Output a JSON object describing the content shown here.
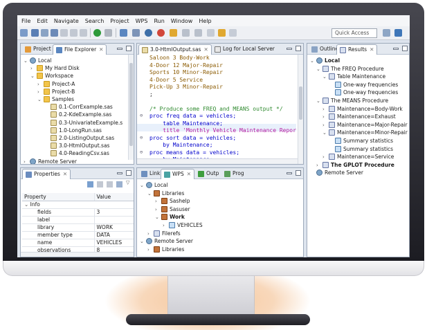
{
  "menu": [
    "File",
    "Edit",
    "Navigate",
    "Search",
    "Project",
    "WPS",
    "Run",
    "Window",
    "Help"
  ],
  "quick_access": "Quick Access",
  "left_panel": {
    "tabs": [
      "Project",
      "File Explorer"
    ],
    "tree": [
      {
        "label": "Local",
        "indent": 0,
        "arrow": "v",
        "icon": "computer"
      },
      {
        "label": "My Hard Disk",
        "indent": 1,
        "arrow": ">",
        "icon": "folder"
      },
      {
        "label": "Workspace",
        "indent": 1,
        "arrow": "v",
        "icon": "folder"
      },
      {
        "label": "Project-A",
        "indent": 2,
        "arrow": ">",
        "icon": "folder"
      },
      {
        "label": "Project-B",
        "indent": 2,
        "arrow": ">",
        "icon": "folder"
      },
      {
        "label": "Samples",
        "indent": 2,
        "arrow": "v",
        "icon": "folder"
      },
      {
        "label": "0.1-CorrExample.sas",
        "indent": 3,
        "arrow": "",
        "icon": "sas"
      },
      {
        "label": "0.2-KdeExample.sas",
        "indent": 3,
        "arrow": "",
        "icon": "sas"
      },
      {
        "label": "0.3-UnivariateExample.s",
        "indent": 3,
        "arrow": "",
        "icon": "sas"
      },
      {
        "label": "1.0-LongRun.sas",
        "indent": 3,
        "arrow": "",
        "icon": "sas"
      },
      {
        "label": "2.0-ListingOutput.sas",
        "indent": 3,
        "arrow": "",
        "icon": "sas"
      },
      {
        "label": "3.0-HtmlOutput.sas",
        "indent": 3,
        "arrow": "",
        "icon": "sas"
      },
      {
        "label": "4.0-ReadingCsv.sas",
        "indent": 3,
        "arrow": "",
        "icon": "sas"
      },
      {
        "label": "Remote Server",
        "indent": 0,
        "arrow": ">",
        "icon": "server"
      }
    ]
  },
  "properties": {
    "tab": "Properties",
    "col_property": "Property",
    "col_value": "Value",
    "group": "Info",
    "rows": [
      {
        "name": "fields",
        "value": "3"
      },
      {
        "name": "label",
        "value": ""
      },
      {
        "name": "library",
        "value": "WORK"
      },
      {
        "name": "member type",
        "value": "DATA"
      },
      {
        "name": "name",
        "value": "VEHICLES"
      },
      {
        "name": "observations",
        "value": "8"
      }
    ]
  },
  "editor": {
    "tabs": [
      "3.0-HtmlOutput.sas",
      "Log for Local Server"
    ],
    "lines": [
      {
        "t": "Saloon 3 Body-Work",
        "c": "datal"
      },
      {
        "t": "4-Door 12 Major-Repair",
        "c": "datal"
      },
      {
        "t": "Sports 10 Minor-Repair",
        "c": "datal"
      },
      {
        "t": "4-Door 5 Service",
        "c": "datal"
      },
      {
        "t": "Pick-Up 3 Minor-Repair",
        "c": "datal"
      },
      {
        "t": ";",
        "c": ""
      },
      {
        "t": "",
        "c": ""
      },
      {
        "t": "/* Produce some FREQ and MEANS output */",
        "c": "cmt"
      },
      {
        "t": "proc freq data = vehicles;",
        "c": "kw",
        "fold": true
      },
      {
        "t": "    table Maintenance;",
        "c": "kw"
      },
      {
        "t": "    title 'Monthly Vehicle Maintenance Repor",
        "c": "str"
      },
      {
        "t": "proc sort data = vehicles;",
        "c": "kw",
        "fold": true
      },
      {
        "t": "    by Maintenance;",
        "c": "kw"
      },
      {
        "t": "proc means data = vehicles;",
        "c": "kw",
        "fold": true
      },
      {
        "t": "    by Maintenance;",
        "c": "kw"
      },
      {
        "t": "run;",
        "c": "kw"
      }
    ]
  },
  "bottom_panel": {
    "tabs": [
      "Link",
      "WPS",
      "Outp",
      "Prog"
    ],
    "tree": [
      {
        "label": "Local",
        "indent": 0,
        "arrow": "v",
        "icon": "server"
      },
      {
        "label": "Libraries",
        "indent": 1,
        "arrow": "v",
        "icon": "lib"
      },
      {
        "label": "Sashelp",
        "indent": 2,
        "arrow": ">",
        "icon": "lib"
      },
      {
        "label": "Sasuser",
        "indent": 2,
        "arrow": ">",
        "icon": "lib"
      },
      {
        "label": "Work",
        "indent": 2,
        "arrow": "v",
        "icon": "lib",
        "bold": true
      },
      {
        "label": "VEHICLES",
        "indent": 3,
        "arrow": ">",
        "icon": "table"
      },
      {
        "label": "Filerefs",
        "indent": 1,
        "arrow": ">",
        "icon": "doc"
      },
      {
        "label": "Remote Server",
        "indent": 0,
        "arrow": "v",
        "icon": "server"
      },
      {
        "label": "Libraries",
        "indent": 1,
        "arrow": ">",
        "icon": "lib"
      }
    ]
  },
  "results_panel": {
    "tabs": [
      "Outline",
      "Results"
    ],
    "tree": [
      {
        "label": "Local",
        "indent": 0,
        "arrow": "v",
        "icon": "server",
        "bold": true
      },
      {
        "label": "The FREQ Procedure",
        "indent": 1,
        "arrow": "v",
        "icon": "doc"
      },
      {
        "label": "Table Maintenance",
        "indent": 2,
        "arrow": "v",
        "icon": "doc"
      },
      {
        "label": "One-way frequencies",
        "indent": 3,
        "arrow": "",
        "icon": "table"
      },
      {
        "label": "One-way frequencies",
        "indent": 3,
        "arrow": "",
        "icon": "table"
      },
      {
        "label": "The MEANS Procedure",
        "indent": 1,
        "arrow": "v",
        "icon": "doc"
      },
      {
        "label": "Maintenance=Body-Work",
        "indent": 2,
        "arrow": ">",
        "icon": "doc"
      },
      {
        "label": "Maintenance=Exhaust",
        "indent": 2,
        "arrow": ">",
        "icon": "doc"
      },
      {
        "label": "Maintenance=Major-Repair",
        "indent": 2,
        "arrow": ">",
        "icon": "doc"
      },
      {
        "label": "Maintenance=Minor-Repair",
        "indent": 2,
        "arrow": "v",
        "icon": "doc"
      },
      {
        "label": "Summary statistics",
        "indent": 3,
        "arrow": "",
        "icon": "table"
      },
      {
        "label": "Summary statistics",
        "indent": 3,
        "arrow": "",
        "icon": "table"
      },
      {
        "label": "Maintenance=Service",
        "indent": 2,
        "arrow": ">",
        "icon": "doc"
      },
      {
        "label": "The GPLOT Procedure",
        "indent": 1,
        "arrow": ">",
        "icon": "doc",
        "bold": true
      },
      {
        "label": "Remote Server",
        "indent": 0,
        "arrow": "",
        "icon": "server"
      }
    ]
  }
}
